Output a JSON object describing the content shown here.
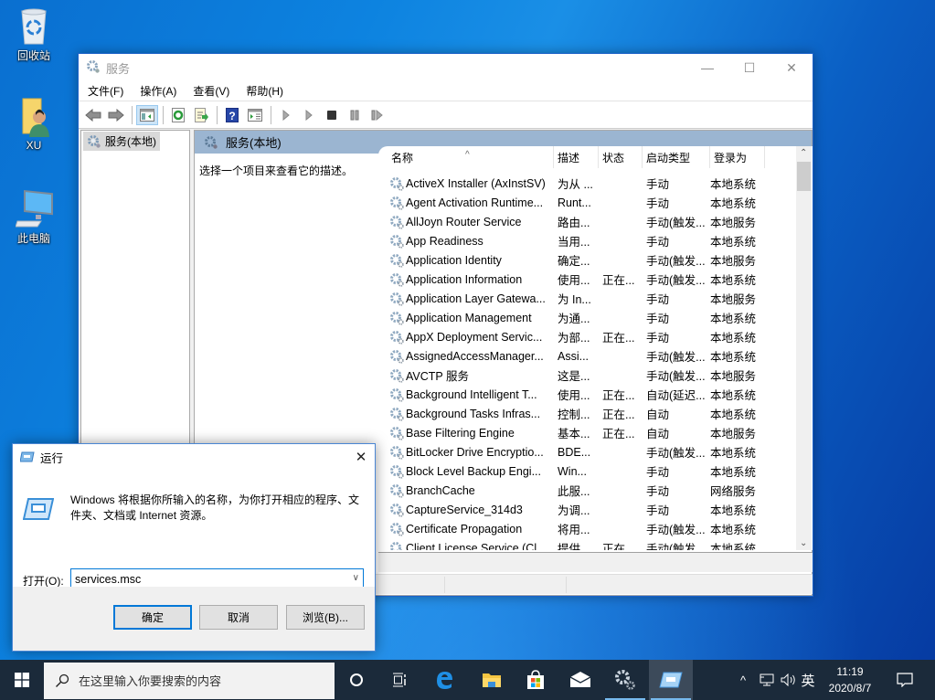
{
  "desktop": {
    "icons": [
      {
        "label": "回收站",
        "icon": "recycle-bin-icon"
      },
      {
        "label": "XU",
        "icon": "user-folder-icon"
      },
      {
        "label": "此电脑",
        "icon": "this-pc-icon"
      }
    ]
  },
  "services_window": {
    "title": "服务",
    "controls": {
      "minimize": "—",
      "maximize": "☐",
      "close": "✕"
    },
    "menu": [
      "文件(F)",
      "操作(A)",
      "查看(V)",
      "帮助(H)"
    ],
    "toolbar": [
      "back-icon",
      "forward-icon",
      "show-hide-console-tree-icon",
      "refresh-icon",
      "export-list-icon",
      "help-icon",
      "properties-icon",
      "start-service-icon",
      "start-service-alt-icon",
      "stop-service-icon",
      "pause-service-icon",
      "restart-service-icon"
    ],
    "tree": {
      "root": "服务(本地)"
    },
    "content_header": "服务(本地)",
    "description_hint": "选择一个项目来查看它的描述。",
    "columns": [
      "名称",
      "描述",
      "状态",
      "启动类型",
      "登录为"
    ],
    "sort_indicator": "^",
    "rows": [
      {
        "name": "ActiveX Installer (AxInstSV)",
        "desc": "为从 ...",
        "status": "",
        "startup": "手动",
        "logon": "本地系统"
      },
      {
        "name": "Agent Activation Runtime...",
        "desc": "Runt...",
        "status": "",
        "startup": "手动",
        "logon": "本地系统"
      },
      {
        "name": "AllJoyn Router Service",
        "desc": "路由...",
        "status": "",
        "startup": "手动(触发...",
        "logon": "本地服务"
      },
      {
        "name": "App Readiness",
        "desc": "当用...",
        "status": "",
        "startup": "手动",
        "logon": "本地系统"
      },
      {
        "name": "Application Identity",
        "desc": "确定...",
        "status": "",
        "startup": "手动(触发...",
        "logon": "本地服务"
      },
      {
        "name": "Application Information",
        "desc": "使用...",
        "status": "正在...",
        "startup": "手动(触发...",
        "logon": "本地系统"
      },
      {
        "name": "Application Layer Gatewa...",
        "desc": "为 In...",
        "status": "",
        "startup": "手动",
        "logon": "本地服务"
      },
      {
        "name": "Application Management",
        "desc": "为通...",
        "status": "",
        "startup": "手动",
        "logon": "本地系统"
      },
      {
        "name": "AppX Deployment Servic...",
        "desc": "为部...",
        "status": "正在...",
        "startup": "手动",
        "logon": "本地系统"
      },
      {
        "name": "AssignedAccessManager...",
        "desc": "Assi...",
        "status": "",
        "startup": "手动(触发...",
        "logon": "本地系统"
      },
      {
        "name": "AVCTP 服务",
        "desc": "这是...",
        "status": "",
        "startup": "手动(触发...",
        "logon": "本地服务"
      },
      {
        "name": "Background Intelligent T...",
        "desc": "使用...",
        "status": "正在...",
        "startup": "自动(延迟...",
        "logon": "本地系统"
      },
      {
        "name": "Background Tasks Infras...",
        "desc": "控制...",
        "status": "正在...",
        "startup": "自动",
        "logon": "本地系统"
      },
      {
        "name": "Base Filtering Engine",
        "desc": "基本...",
        "status": "正在...",
        "startup": "自动",
        "logon": "本地服务"
      },
      {
        "name": "BitLocker Drive Encryptio...",
        "desc": "BDE...",
        "status": "",
        "startup": "手动(触发...",
        "logon": "本地系统"
      },
      {
        "name": "Block Level Backup Engi...",
        "desc": "Win...",
        "status": "",
        "startup": "手动",
        "logon": "本地系统"
      },
      {
        "name": "BranchCache",
        "desc": "此服...",
        "status": "",
        "startup": "手动",
        "logon": "网络服务"
      },
      {
        "name": "CaptureService_314d3",
        "desc": "为调...",
        "status": "",
        "startup": "手动",
        "logon": "本地系统"
      },
      {
        "name": "Certificate Propagation",
        "desc": "将用...",
        "status": "",
        "startup": "手动(触发...",
        "logon": "本地系统"
      },
      {
        "name": "Client License Service (Cl...",
        "desc": "提供...",
        "status": "正在...",
        "startup": "手动(触发...",
        "logon": "本地系统"
      }
    ]
  },
  "run_dialog": {
    "title": "运行",
    "close": "✕",
    "description": "Windows 将根据你所输入的名称，为你打开相应的程序、文件夹、文档或 Internet 资源。",
    "open_label": "打开(O):",
    "input_value": "services.msc",
    "buttons": {
      "ok": "确定",
      "cancel": "取消",
      "browse": "浏览(B)..."
    }
  },
  "taskbar": {
    "search_placeholder": "在这里输入你要搜索的内容",
    "apps": [
      "cortana-icon",
      "task-view-icon",
      "edge-icon",
      "file-explorer-icon",
      "store-icon",
      "mail-icon",
      "services-icon",
      "run-icon"
    ],
    "tray": {
      "chevron": "^",
      "input_method": "英"
    },
    "time": "11:19",
    "date": "2020/8/7"
  },
  "colors": {
    "accent": "#0078d7",
    "header_blue": "#9bb5d1",
    "taskbar": "#1b2a3a"
  }
}
